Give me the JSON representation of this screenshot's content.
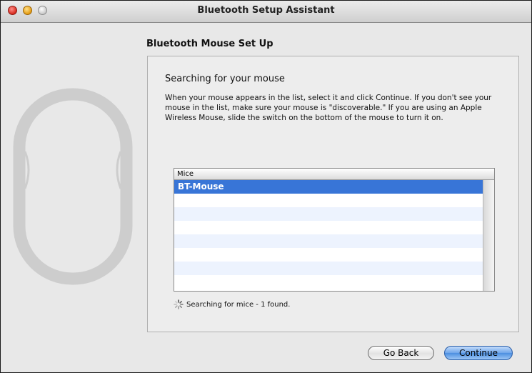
{
  "window": {
    "title": "Bluetooth Setup Assistant",
    "controls": [
      "close",
      "minimize",
      "zoom"
    ]
  },
  "section_title": "Bluetooth Mouse Set Up",
  "panel": {
    "heading": "Searching for your mouse",
    "description": "When your mouse appears in the list, select it and click Continue. If you don't see your mouse in the list, make sure your mouse is \"discoverable.\"  If you are using an Apple Wireless Mouse, slide the switch on the bottom of the mouse to turn it on."
  },
  "device_list": {
    "column_header": "Mice",
    "items": [
      {
        "label": "BT-Mouse",
        "selected": true
      }
    ]
  },
  "status": {
    "icon": "spinner-icon",
    "text": "Searching for mice - 1 found."
  },
  "buttons": {
    "back": "Go Back",
    "continue": "Continue"
  },
  "colors": {
    "selection": "#3875d7",
    "alt_row": "#edf3fe",
    "default_button": "#4c8fe1"
  }
}
